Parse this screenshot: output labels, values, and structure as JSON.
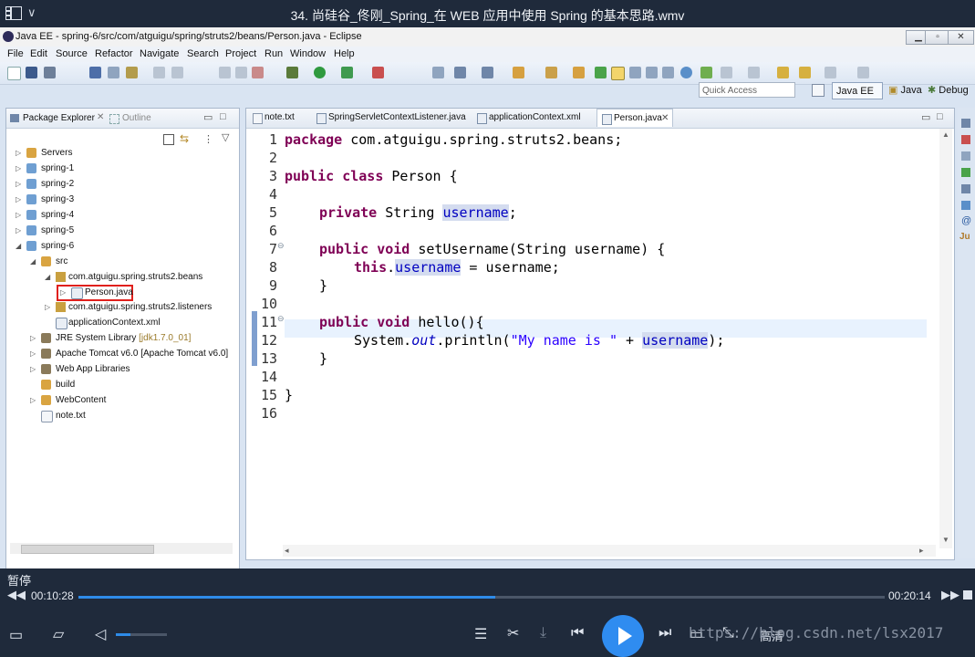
{
  "player": {
    "video_title": "34. 尚硅谷_佟刚_Spring_在 WEB 应用中使用 Spring 的基本思路.wmv",
    "status": "暂停",
    "time_elapsed": "00:10:28",
    "time_total": "00:20:14",
    "progress": 0.517,
    "watermark": "https://blog.csdn.net/lsx2017",
    "quality_label": "高清"
  },
  "eclipse": {
    "window_title": "Java EE - spring-6/src/com/atguigu/spring/struts2/beans/Person.java - Eclipse",
    "menu": [
      "File",
      "Edit",
      "Source",
      "Refactor",
      "Navigate",
      "Search",
      "Project",
      "Run",
      "Window",
      "Help"
    ],
    "quick_access_placeholder": "Quick Access",
    "perspectives": [
      "Java EE",
      "Java",
      "Debug"
    ],
    "package_explorer": {
      "tab_label": "Package Explorer",
      "outline_label": "Outline",
      "tree": [
        {
          "label": "Servers"
        },
        {
          "label": "spring-1"
        },
        {
          "label": "spring-2"
        },
        {
          "label": "spring-3"
        },
        {
          "label": "spring-4"
        },
        {
          "label": "spring-5"
        },
        {
          "label": "spring-6"
        },
        {
          "label": "src"
        },
        {
          "label": "com.atguigu.spring.struts2.beans"
        },
        {
          "label": "Person.java"
        },
        {
          "label": "com.atguigu.spring.struts2.listeners"
        },
        {
          "label": "applicationContext.xml"
        },
        {
          "label": "JRE System Library",
          "suffix": "[jdk1.7.0_01]"
        },
        {
          "label": "Apache Tomcat v6.0 [Apache Tomcat v6.0]"
        },
        {
          "label": "Web App Libraries"
        },
        {
          "label": "build"
        },
        {
          "label": "WebContent"
        },
        {
          "label": "note.txt"
        }
      ]
    },
    "editor_tabs": [
      "note.txt",
      "SpringServletContextListener.java",
      "applicationContext.xml",
      "Person.java"
    ],
    "line_numbers": [
      "1",
      "2",
      "3",
      "4",
      "5",
      "6",
      "7",
      "8",
      "9",
      "10",
      "11",
      "12",
      "13",
      "14",
      "15",
      "16"
    ]
  }
}
